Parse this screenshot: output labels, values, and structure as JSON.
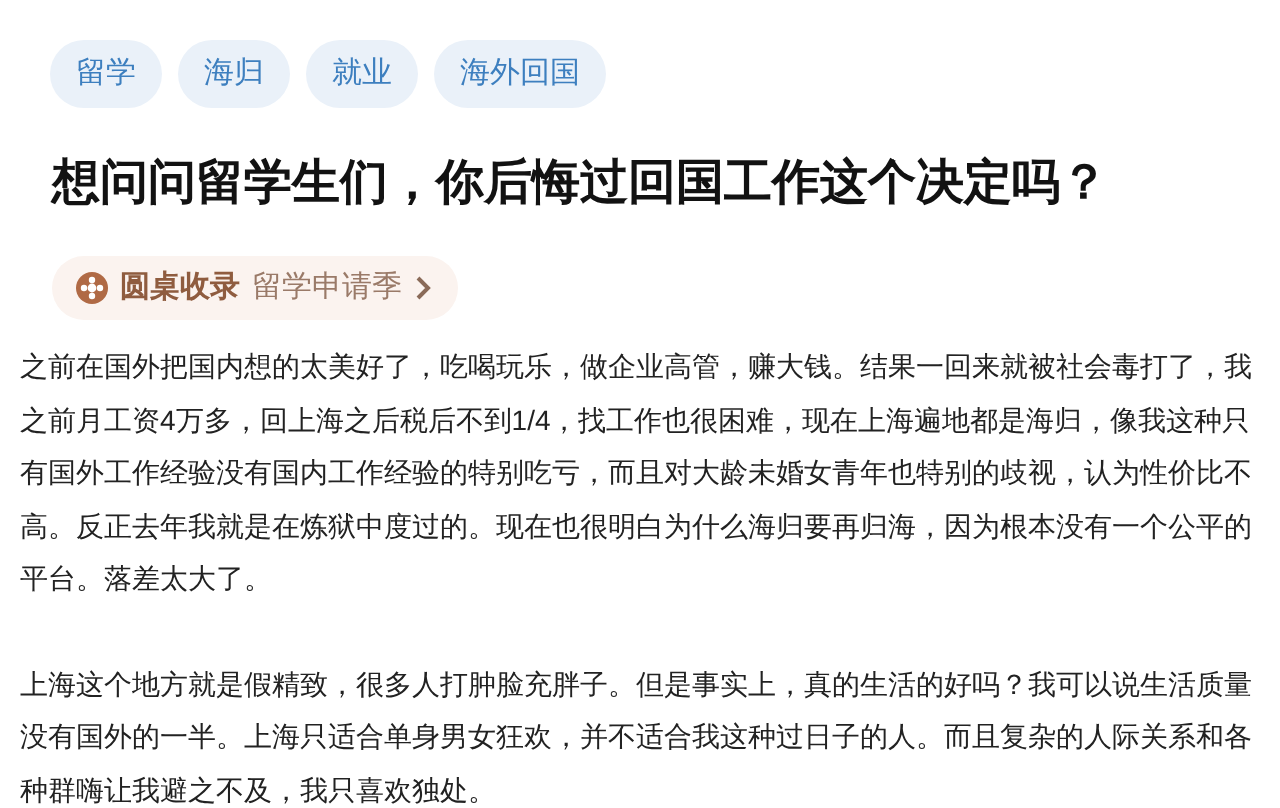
{
  "tags": [
    "留学",
    "海归",
    "就业",
    "海外回国"
  ],
  "question": {
    "title": "想问问留学生们，你后悔过回国工作这个决定吗？"
  },
  "roundtable": {
    "label": "圆桌收录",
    "name": "留学申请季"
  },
  "answer": {
    "paragraphs": [
      "之前在国外把国内想的太美好了，吃喝玩乐，做企业高管，赚大钱。结果一回来就被社会毒打了，我之前月工资4万多，回上海之后税后不到1/4，找工作也很困难，现在上海遍地都是海归，像我这种只有国外工作经验没有国内工作经验的特别吃亏，而且对大龄未婚女青年也特别的歧视，认为性价比不高。反正去年我就是在炼狱中度过的。现在也很明白为什么海归要再归海，因为根本没有一个公平的平台。落差太大了。",
      "上海这个地方就是假精致，很多人打肿脸充胖子。但是事实上，真的生活的好吗？我可以说生活质量没有国外的一半。上海只适合单身男女狂欢，并不适合我这种过日子的人。而且复杂的人际关系和各种群嗨让我避之不及，我只喜欢独处。"
    ]
  }
}
